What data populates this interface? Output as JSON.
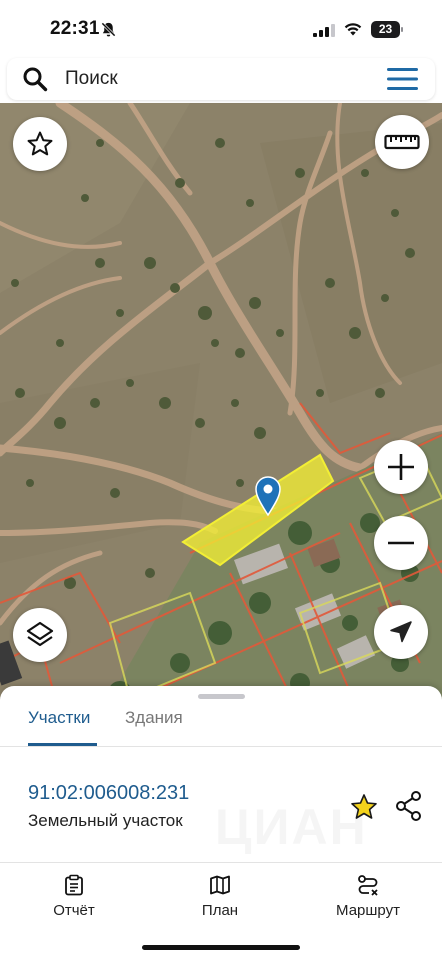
{
  "status_bar": {
    "time": "22:31",
    "battery": "23"
  },
  "search": {
    "placeholder": "Поиск"
  },
  "map": {
    "icons": [
      "star-icon",
      "ruler-icon",
      "plus-icon",
      "minus-icon",
      "layers-icon",
      "navigation-arrow-icon",
      "map-pin-icon"
    ],
    "colors": {
      "parcel_fill": "#f2ee35",
      "parcel_border": "#e85a3a",
      "pin": "#1f72b8"
    }
  },
  "sheet": {
    "tabs": [
      {
        "label": "Участки",
        "active": true
      },
      {
        "label": "Здания",
        "active": false
      }
    ],
    "parcel": {
      "cadastral_number": "91:02:006008:231",
      "type": "Земельный участок"
    },
    "watermark": "ЦИАН"
  },
  "bottom_nav": [
    {
      "label": "Отчёт",
      "icon": "report-icon"
    },
    {
      "label": "План",
      "icon": "map-icon"
    },
    {
      "label": "Маршрут",
      "icon": "route-icon"
    }
  ],
  "colors": {
    "accent": "#1f5c8e",
    "star": "#e8c21c"
  }
}
